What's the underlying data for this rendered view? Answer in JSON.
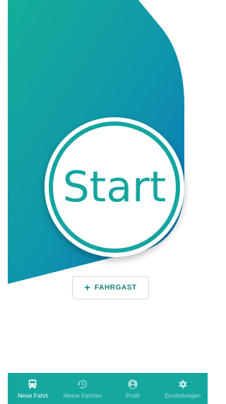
{
  "main": {
    "start_label": "Start",
    "add_passenger_label": "FAHRGAST",
    "add_icon": "plus-icon"
  },
  "nav": {
    "items": [
      {
        "label": "Neue Fahrt",
        "icon": "bus-icon",
        "active": true
      },
      {
        "label": "Meine Fahrten",
        "icon": "history-icon",
        "active": false
      },
      {
        "label": "Profil",
        "icon": "account-icon",
        "active": false
      },
      {
        "label": "Einstellungen",
        "icon": "gear-icon",
        "active": false
      }
    ]
  },
  "colors": {
    "brand_teal": "#15a89e",
    "brand_blue": "#0a73b5",
    "nav_background": "#15a89e",
    "text_on_white": "#157d7a"
  }
}
